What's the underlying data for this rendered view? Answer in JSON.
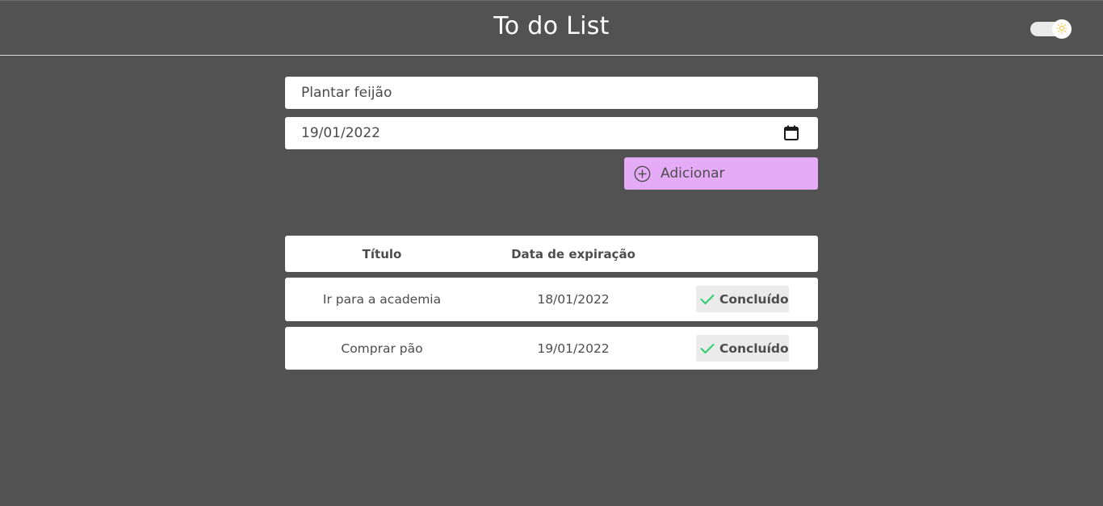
{
  "header": {
    "title": "To do List"
  },
  "theme_toggle": {
    "icon": "sun-icon",
    "state": "on"
  },
  "form": {
    "task_value": "Plantar feijão",
    "date_value": "19/01/2022",
    "add_label": "Adicionar"
  },
  "table": {
    "headers": {
      "title": "Título",
      "date": "Data de expiração"
    },
    "rows": [
      {
        "title": "Ir para a academia",
        "date": "18/01/2022",
        "action": "Concluído"
      },
      {
        "title": "Comprar pão",
        "date": "19/01/2022",
        "action": "Concluído"
      }
    ]
  },
  "colors": {
    "background": "#525252",
    "accent_button": "#e6abf7",
    "check": "#2ecc71"
  }
}
